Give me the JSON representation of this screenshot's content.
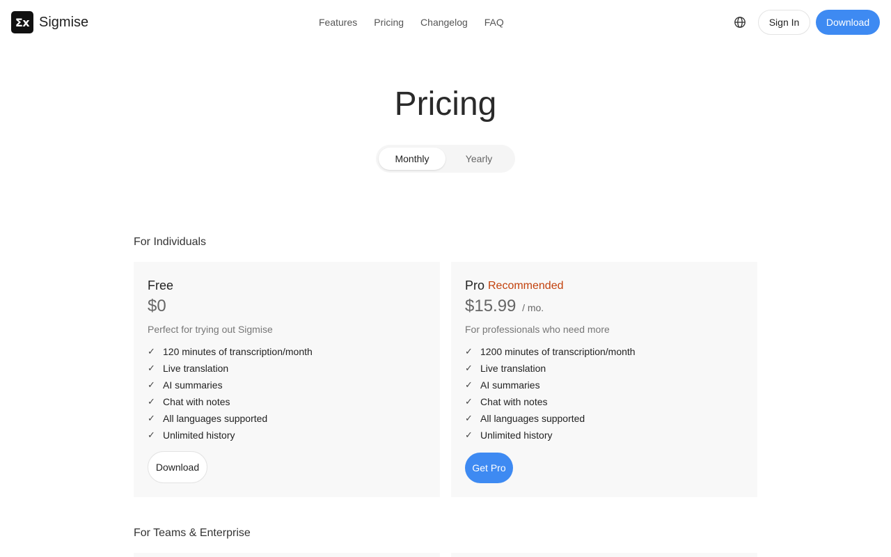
{
  "header": {
    "logo_text": "Σx",
    "brand": "Sigmise",
    "nav": [
      "Features",
      "Pricing",
      "Changelog",
      "FAQ"
    ],
    "language_icon": "globe-icon",
    "sign_in": "Sign In",
    "download": "Download"
  },
  "hero": {
    "title": "Pricing",
    "billing_options": [
      "Monthly",
      "Yearly"
    ],
    "selected_billing": "Monthly"
  },
  "individuals": {
    "label": "For Individuals",
    "plans": [
      {
        "name": "Free",
        "price": "$0",
        "description": "Perfect for trying out Sigmise",
        "features": [
          "120 minutes of transcription/month",
          "Live translation",
          "AI summaries",
          "Chat with notes",
          "All languages supported",
          "Unlimited history"
        ],
        "cta": "Download"
      },
      {
        "name": "Pro",
        "badge": "Recommended",
        "price": "$15.99",
        "period": "/ mo.",
        "description": "For professionals who need more",
        "features": [
          "1200 minutes of transcription/month",
          "Live translation",
          "AI summaries",
          "Chat with notes",
          "All languages supported",
          "Unlimited history"
        ],
        "cta": "Get Pro"
      }
    ]
  },
  "teams": {
    "label": "For Teams & Enterprise"
  },
  "check_symbol": "✓",
  "colors": {
    "accent": "#3e8af2",
    "badge": "#c2410c",
    "card_bg": "#f8f8f8"
  }
}
